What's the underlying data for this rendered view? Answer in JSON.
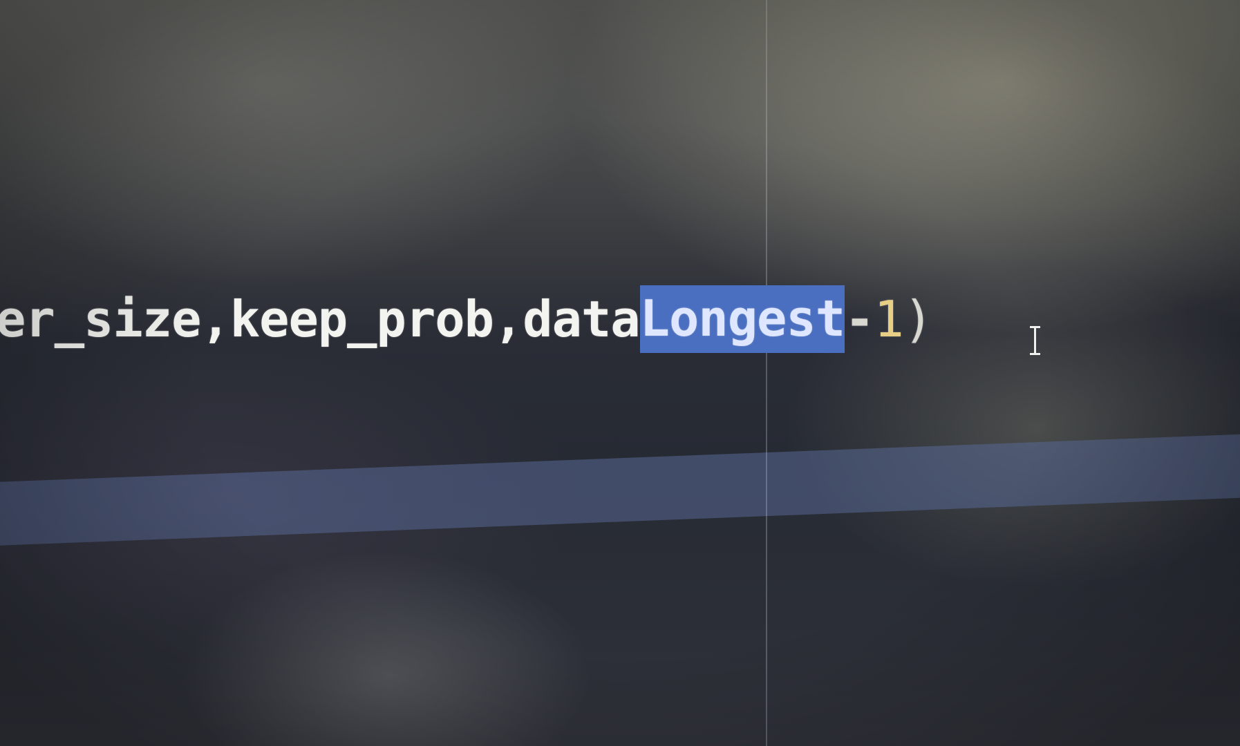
{
  "editor": {
    "code_line": {
      "before_selection": "er_size,keep_prob,data",
      "selected_text": "Longest",
      "operator": "-",
      "number": "1",
      "close_paren": ")"
    },
    "colors": {
      "selection_background": "#4a6fc0",
      "current_line_highlight": "#586894",
      "number_literal": "#e8cf86",
      "text": "#f3f3f0"
    },
    "cursor_icon": "text-cursor-ibeam-icon"
  }
}
